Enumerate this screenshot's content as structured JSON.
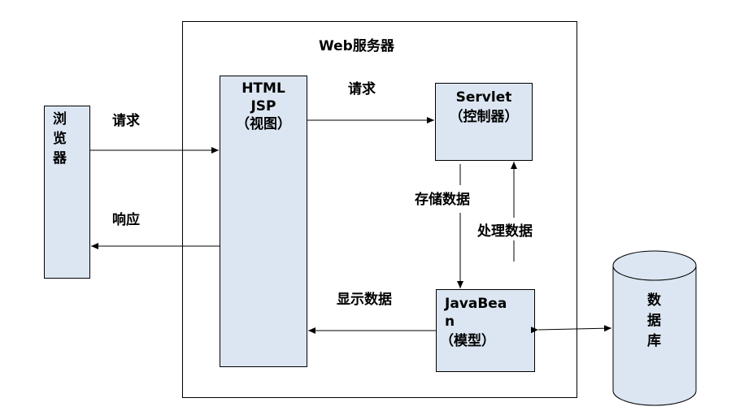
{
  "server": {
    "title": "Web服务器"
  },
  "browser": {
    "label": "浏览器"
  },
  "view": {
    "line1": "HTML",
    "line2": "JSP",
    "line3": "（视图）"
  },
  "controller": {
    "line1": "Servlet",
    "line2": "（控制器）"
  },
  "model": {
    "line1": "JavaBea",
    "line2": "n",
    "line3": "（模型）"
  },
  "database": {
    "label": "数据库"
  },
  "arrows": {
    "browser_request": "请求",
    "browser_response": "响应",
    "view_request": "请求",
    "store_data": "存储数据",
    "process_data": "处理数据",
    "display_data": "显示数据"
  },
  "colors": {
    "box_fill": "#dce6f2",
    "line": "#000000"
  }
}
